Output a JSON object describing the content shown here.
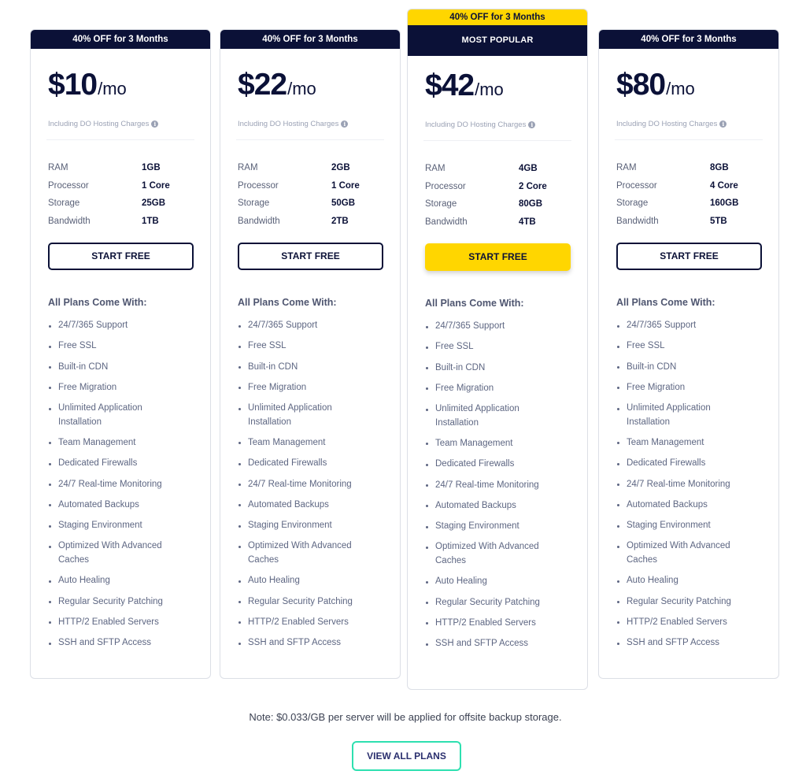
{
  "plans": [
    {
      "offer": "40% OFF for 3 Months",
      "badge": null,
      "price": "$10",
      "period": "/mo",
      "including": "Including DO Hosting Charges",
      "specs": [
        {
          "label": "RAM",
          "value": "1GB"
        },
        {
          "label": "Processor",
          "value": "1 Core"
        },
        {
          "label": "Storage",
          "value": "25GB"
        },
        {
          "label": "Bandwidth",
          "value": "1TB"
        }
      ],
      "cta": "START FREE",
      "featured": false
    },
    {
      "offer": "40% OFF for 3 Months",
      "badge": null,
      "price": "$22",
      "period": "/mo",
      "including": "Including DO Hosting Charges",
      "specs": [
        {
          "label": "RAM",
          "value": "2GB"
        },
        {
          "label": "Processor",
          "value": "1 Core"
        },
        {
          "label": "Storage",
          "value": "50GB"
        },
        {
          "label": "Bandwidth",
          "value": "2TB"
        }
      ],
      "cta": "START FREE",
      "featured": false
    },
    {
      "offer": "40% OFF for 3 Months",
      "badge": "MOST POPULAR",
      "price": "$42",
      "period": "/mo",
      "including": "Including DO Hosting Charges",
      "specs": [
        {
          "label": "RAM",
          "value": "4GB"
        },
        {
          "label": "Processor",
          "value": "2 Core"
        },
        {
          "label": "Storage",
          "value": "80GB"
        },
        {
          "label": "Bandwidth",
          "value": "4TB"
        }
      ],
      "cta": "START FREE",
      "featured": true
    },
    {
      "offer": "40% OFF for 3 Months",
      "badge": null,
      "price": "$80",
      "period": "/mo",
      "including": "Including DO Hosting Charges",
      "specs": [
        {
          "label": "RAM",
          "value": "8GB"
        },
        {
          "label": "Processor",
          "value": "4 Core"
        },
        {
          "label": "Storage",
          "value": "160GB"
        },
        {
          "label": "Bandwidth",
          "value": "5TB"
        }
      ],
      "cta": "START FREE",
      "featured": false
    }
  ],
  "features_title": "All Plans Come With:",
  "features": [
    "24/7/365 Support",
    "Free SSL",
    "Built-in CDN",
    "Free Migration",
    "Unlimited Application Installation",
    "Team Management",
    "Dedicated Firewalls",
    "24/7 Real-time Monitoring",
    "Automated Backups",
    "Staging Environment",
    "Optimized With Advanced Caches",
    "Auto Healing",
    "Regular Security Patching",
    "HTTP/2 Enabled Servers",
    "SSH and SFTP Access"
  ],
  "note": "Note: $0.033/GB per server will be applied for offsite backup storage.",
  "view_all_label": "VIEW ALL PLANS",
  "colors": {
    "navy": "#0b1137",
    "accent_yellow": "#ffd600",
    "accent_teal": "#2ee0b0"
  }
}
